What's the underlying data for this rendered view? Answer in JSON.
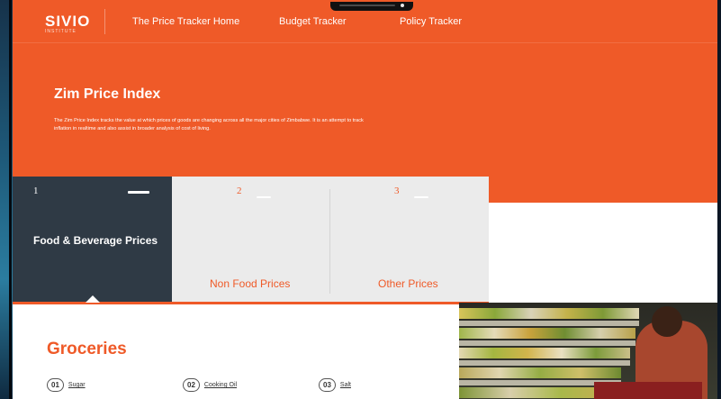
{
  "nav": {
    "logo": "SIVIO",
    "logo_sub": "INSTITUTE",
    "links": [
      "The Price Tracker Home",
      "Budget Tracker",
      "Policy Tracker"
    ]
  },
  "hero": {
    "title": "Zim Price Index",
    "description": "The Zim Price Index tracks the value at which prices of goods are changing across all the major cities of Zimbabwe. It is an attempt to track inflation in realtime and also assist in broader analysis of cost of living."
  },
  "tabs": [
    {
      "number": "1",
      "label": "Food & Beverage Prices",
      "active": true
    },
    {
      "number": "2",
      "label": "Non Food Prices",
      "active": false
    },
    {
      "number": "3",
      "label": "Other Prices",
      "active": false
    }
  ],
  "section": {
    "title": "Groceries",
    "items": [
      {
        "number": "01",
        "label": "Sugar"
      },
      {
        "number": "02",
        "label": "Cooking Oil"
      },
      {
        "number": "03",
        "label": "Salt"
      }
    ]
  },
  "colors": {
    "accent": "#ef5a28",
    "active_tab": "#2f3a45",
    "inactive_tab": "#ebebeb"
  }
}
